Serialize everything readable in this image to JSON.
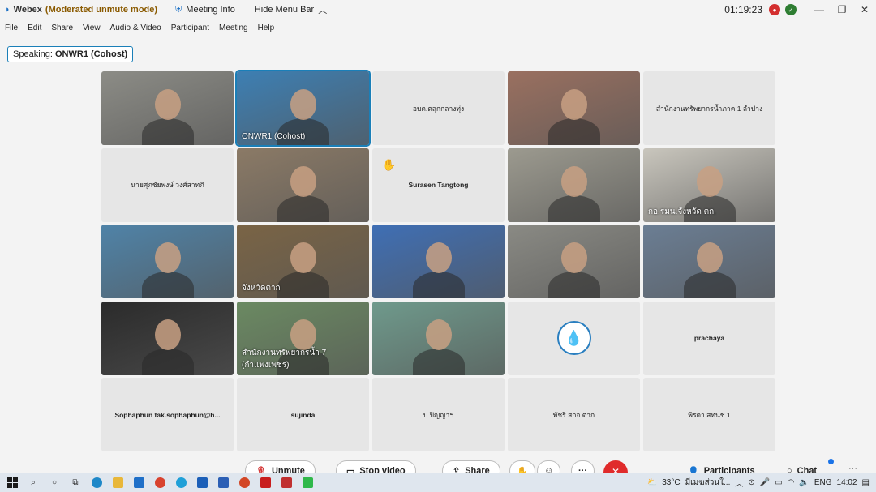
{
  "titlebar": {
    "app_name": "Webex",
    "mode": "(Moderated unmute mode)",
    "meeting_info": "Meeting Info",
    "hide_menu": "Hide Menu Bar",
    "timer": "01:19:23",
    "record_dot_color": "#d32f2f",
    "status_dot_color": "#2e7d32"
  },
  "menu": [
    "File",
    "Edit",
    "Share",
    "View",
    "Audio & Video",
    "Participant",
    "Meeting",
    "Help"
  ],
  "speaking": {
    "label": "Speaking:",
    "name": "ONWR1 (Cohost)"
  },
  "tiles": [
    {
      "name": "",
      "type": "video",
      "bg": "#8c8c86"
    },
    {
      "name": "ONWR1 (Cohost)",
      "type": "video",
      "bg": "#3d7fb3",
      "active": true
    },
    {
      "name": "อบต.ตลุกกลางทุ่ง",
      "type": "name"
    },
    {
      "name": "",
      "type": "video",
      "bg": "#9a7060"
    },
    {
      "name": "สำนักงานทรัพยากรน้ำภาค 1 ลำปาง",
      "type": "name"
    },
    {
      "name": "นายศุภชัยพงษ์ วงศ์สาทภิ",
      "type": "name"
    },
    {
      "name": "",
      "type": "video",
      "bg": "#8b7a66"
    },
    {
      "name": "Surasen Tangtong",
      "type": "name",
      "bold": true,
      "hand": true
    },
    {
      "name": "",
      "type": "video",
      "bg": "#9c9a8f"
    },
    {
      "name": "กอ.รมน.จังหวัด ตก.",
      "type": "video",
      "bg": "#c9c6bd"
    },
    {
      "name": "",
      "type": "video",
      "bg": "#4f83a8"
    },
    {
      "name": "จังหวัดตาก",
      "type": "video",
      "bg": "#7a6445"
    },
    {
      "name": "",
      "type": "video",
      "bg": "#3f6fb5"
    },
    {
      "name": "",
      "type": "video",
      "bg": "#8a8a84"
    },
    {
      "name": "",
      "type": "video",
      "bg": "#6b7e94"
    },
    {
      "name": "",
      "type": "video",
      "bg": "#2b2b2b"
    },
    {
      "name": "สำนักงานทรัพยากรน้ำ 7 (กำแพงเพชร)",
      "type": "video",
      "bg": "#6b8a62"
    },
    {
      "name": "",
      "type": "video",
      "bg": "#6f9a8c"
    },
    {
      "name": "",
      "type": "logo"
    },
    {
      "name": "prachaya",
      "type": "name",
      "bold": true
    },
    {
      "name": "Sophaphun tak.sophaphun@h...",
      "type": "name",
      "bold": true
    },
    {
      "name": "sujinda",
      "type": "name",
      "bold": true
    },
    {
      "name": "บ.ปิญญาฯ",
      "type": "name"
    },
    {
      "name": "พัชรี สกจ.ตาก",
      "type": "name"
    },
    {
      "name": "พิรดา สทนช.1",
      "type": "name"
    }
  ],
  "controls": {
    "unmute": "Unmute",
    "stop_video": "Stop video",
    "share": "Share",
    "participants": "Participants",
    "chat": "Chat"
  },
  "taskbar": {
    "weather": "33°C",
    "weather_text": "มีเมฆส่วนใ...",
    "lang": "ENG",
    "clock": "14:02"
  }
}
